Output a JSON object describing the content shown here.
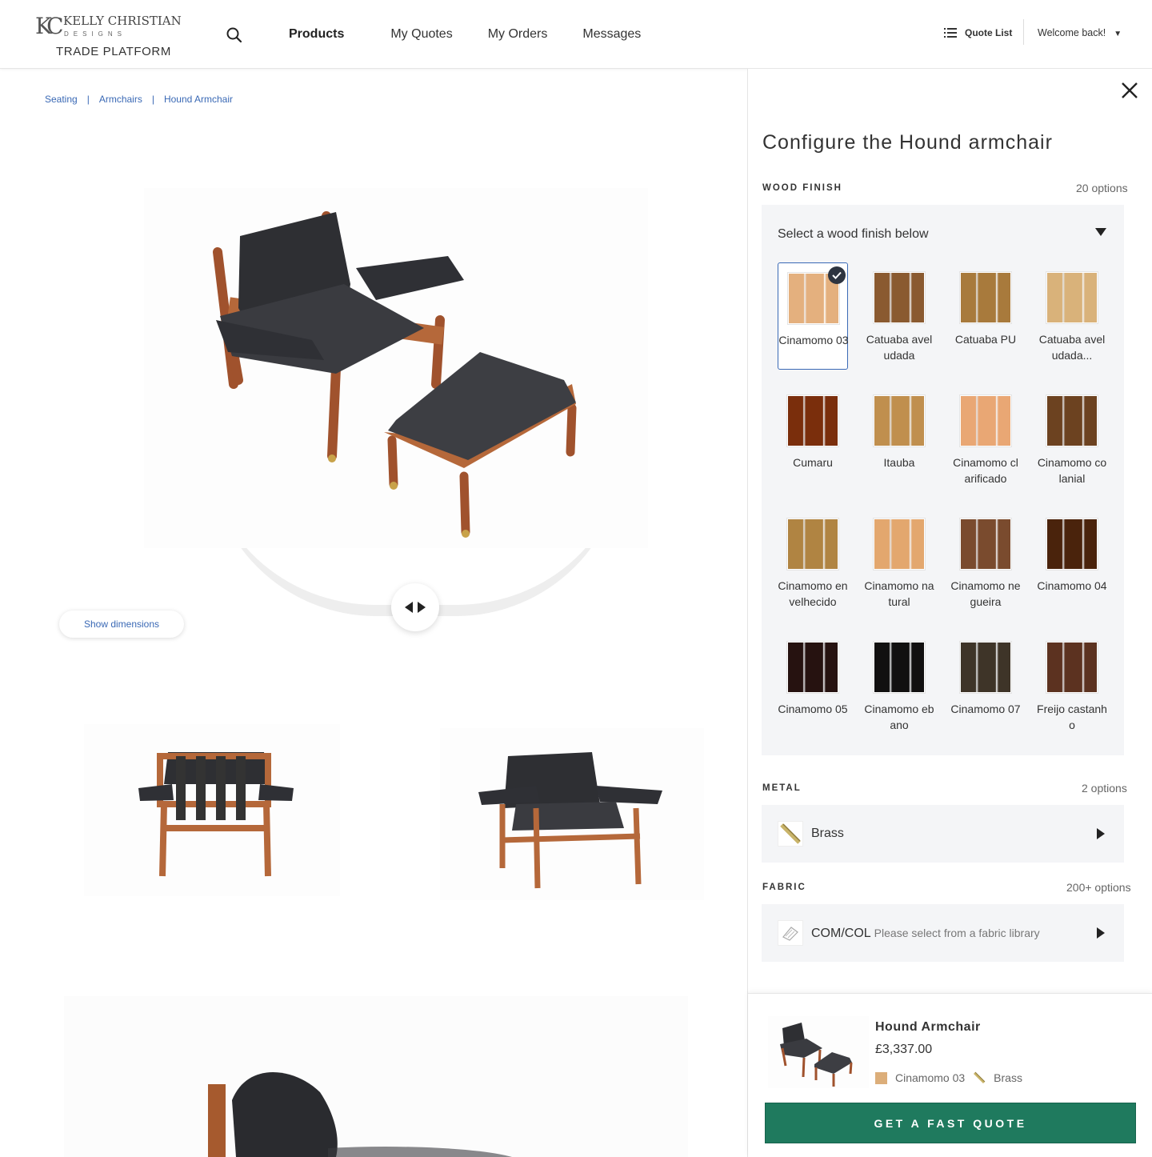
{
  "brand": {
    "name": "KELLY CHRISTIAN",
    "sub": "DESIGNS",
    "platform": "TRADE PLATFORM"
  },
  "nav": [
    "Products",
    "My Quotes",
    "My Orders",
    "Messages"
  ],
  "header": {
    "quote_list": "Quote List",
    "welcome": "Welcome back!"
  },
  "breadcrumb": [
    "Seating",
    "Armchairs",
    "Hound Armchair"
  ],
  "viewer": {
    "show_dimensions": "Show dimensions"
  },
  "configurator": {
    "title": "Configure the Hound armchair",
    "wood": {
      "label": "WOOD FINISH",
      "count": "20 options",
      "select_text": "Select a wood finish below",
      "swatches": [
        {
          "name": "Cinamomo 03",
          "color": "#e4b07e",
          "selected": true
        },
        {
          "name": "Catuaba aveludada",
          "color": "#8a5a30"
        },
        {
          "name": "Catuaba PU",
          "color": "#a87a3c"
        },
        {
          "name": "Catuaba aveludada...",
          "color": "#d9b27a"
        },
        {
          "name": "Cumaru",
          "color": "#7a2e0c"
        },
        {
          "name": "Itauba",
          "color": "#c08f4e"
        },
        {
          "name": "Cinamomo clarificado",
          "color": "#e9a774"
        },
        {
          "name": "Cinamomo colanial",
          "color": "#6c4220"
        },
        {
          "name": "Cinamomo envelhecido",
          "color": "#b08442"
        },
        {
          "name": "Cinamomo natural",
          "color": "#e3a76e"
        },
        {
          "name": "Cinamomo negueira",
          "color": "#7a4b2e"
        },
        {
          "name": "Cinamomo 04",
          "color": "#4a230c"
        },
        {
          "name": "Cinamomo 05",
          "color": "#261210"
        },
        {
          "name": "Cinamomo ebano",
          "color": "#111010"
        },
        {
          "name": "Cinamomo 07",
          "color": "#3e3428"
        },
        {
          "name": "Freijo castanho",
          "color": "#5c3220"
        }
      ]
    },
    "metal": {
      "label": "METAL",
      "count": "2 options",
      "value": "Brass"
    },
    "fabric": {
      "label": "FABRIC",
      "count": "200+ options",
      "value": "COM/COL",
      "hint": "Please select from a fabric library"
    }
  },
  "summary": {
    "name": "Hound Armchair",
    "price": "£3,337.00",
    "wood": "Cinamomo 03",
    "metal": "Brass",
    "cta": "GET A FAST QUOTE"
  },
  "colors": {
    "accent": "#3a69b5",
    "cta": "#1f7a5e",
    "panel_bg": "#f4f5f7"
  }
}
